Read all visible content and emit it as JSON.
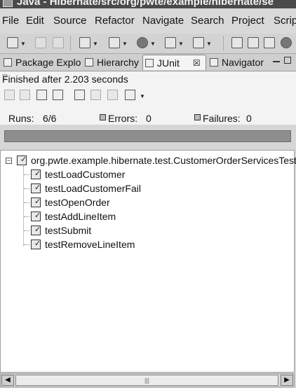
{
  "window": {
    "title": "Java - Hibernate/src/org/pwte/example/hibernate/se"
  },
  "menu": [
    "File",
    "Edit",
    "Source",
    "Refactor",
    "Navigate",
    "Search",
    "Project",
    "Script"
  ],
  "tabs": [
    {
      "label": "Package Explo",
      "icon": "package-explorer-icon"
    },
    {
      "label": "Hierarchy",
      "icon": "hierarchy-icon"
    },
    {
      "label": "JUnit",
      "icon": "junit-icon",
      "active": true,
      "close": "☒"
    },
    {
      "label": "Navigator",
      "icon": "navigator-icon"
    }
  ],
  "junit": {
    "status": "Finished after 2.203 seconds",
    "runs_label": "Runs:",
    "runs_value": "6/6",
    "errors_label": "Errors:",
    "errors_value": "0",
    "failures_label": "Failures:",
    "failures_value": "0",
    "progress_fraction": 1.0,
    "progress_color": "#8e8e8e"
  },
  "tree": {
    "root": "org.pwte.example.hibernate.test.CustomerOrderServicesTest",
    "tests": [
      "testLoadCustomer",
      "testLoadCustomerFail",
      "testOpenOrder",
      "testAddLineItem",
      "testSubmit",
      "testRemoveLineItem"
    ]
  },
  "scrollbar": {
    "left": "◀",
    "right": "▶",
    "grip": "|||"
  }
}
